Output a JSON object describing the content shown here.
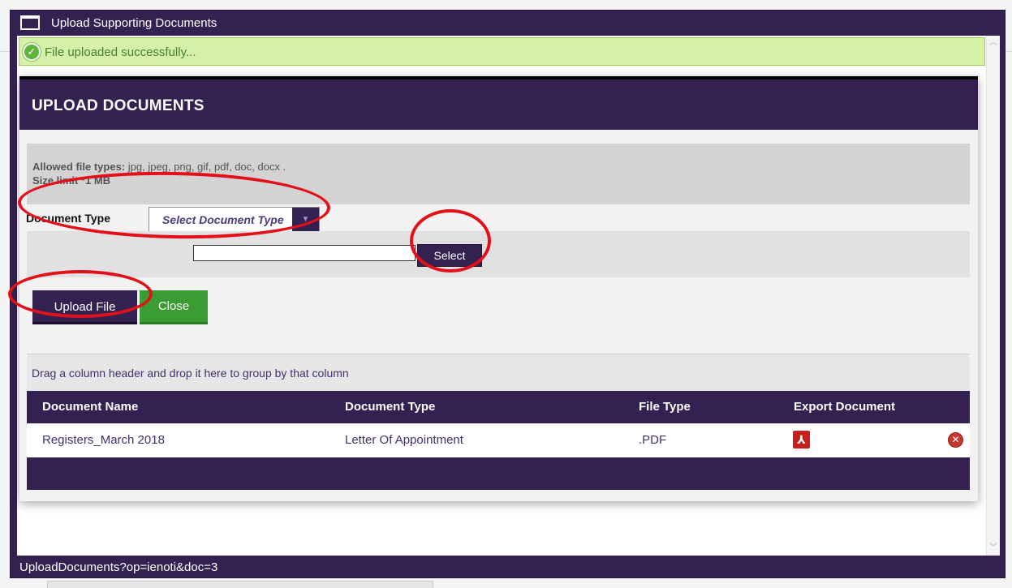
{
  "window": {
    "title": "Upload Supporting Documents",
    "status_url": "UploadDocuments?op=ienoti&doc=3"
  },
  "banner": {
    "message": "File uploaded successfully..."
  },
  "dialog": {
    "title": "UPLOAD DOCUMENTS",
    "allowed_label": "Allowed file types:",
    "allowed_types": "jpg, jpeg, png, gif, pdf, doc, docx .",
    "size_limit": "Size limit *1 MB",
    "document_type_label": "Document Type",
    "document_type_value": "Select Document Type",
    "select_button": "Select",
    "upload_button": "Upload File",
    "close_button": "Close"
  },
  "grid": {
    "group_hint": "Drag a column header and drop it here to group by that column",
    "columns": [
      "Document Name",
      "Document Type",
      "File Type",
      "Export Document"
    ],
    "rows": [
      {
        "document_name": "Registers_March 2018",
        "document_type": "Letter Of Appointment",
        "file_type": ".PDF",
        "export_icon": "pdf-icon",
        "delete_icon": "delete-icon"
      }
    ]
  },
  "colors": {
    "primary": "#332251",
    "success_bg": "#d5f1a6",
    "close_green": "#3c9c34",
    "annotation_red": "#e3101a"
  }
}
